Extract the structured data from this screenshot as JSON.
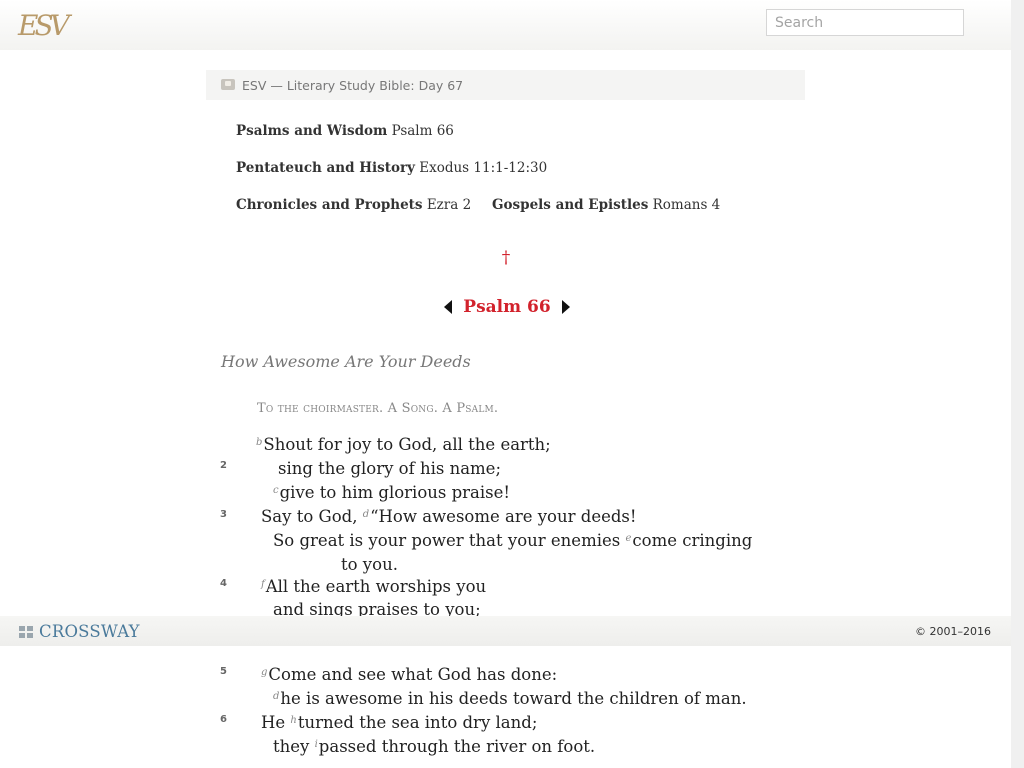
{
  "header": {
    "logo_text": "ESV",
    "search_placeholder": "Search"
  },
  "plan": {
    "title": "ESV — Literary Study Bible: Day 67",
    "readings": [
      {
        "category": "Psalms and Wisdom",
        "ref": "Psalm 66"
      },
      {
        "category": "Pentateuch and History",
        "ref": "Exodus 11:1-12:30"
      },
      {
        "category": "Chronicles and Prophets",
        "ref": "Ezra 2"
      },
      {
        "category": "Gospels and Epistles",
        "ref": "Romans 4"
      }
    ],
    "cross_glyph": "†"
  },
  "chapter": {
    "title": "Psalm 66",
    "section_heading": "How Awesome Are Your Deeds",
    "superscription": "To the choirmaster. A Song. A Psalm.",
    "verse_numbers": [
      "2",
      "3",
      "4",
      "5",
      "6"
    ],
    "lines": [
      {
        "fn": "b",
        "text": "Shout for joy to God, all the earth;"
      },
      {
        "fn": "",
        "text": "sing the glory of his name;"
      },
      {
        "fn": "c",
        "text": "give to him glorious praise!"
      },
      {
        "pre": "Say to God, ",
        "fn": "d",
        "text": "“How awesome are your deeds!"
      },
      {
        "pre": "So great is your power that your enemies ",
        "fn": "e",
        "text": "come cringing"
      },
      {
        "fn": "",
        "text": "to you."
      },
      {
        "fn": "f",
        "text": "All the earth worships you"
      },
      {
        "fn": "",
        "text": "and sings praises to you;"
      },
      {
        "fn": "g",
        "text": "Come and see what God has done:"
      },
      {
        "fn": "d",
        "text": "he is awesome in his deeds toward the children of man."
      },
      {
        "pre": "He ",
        "fn": "h",
        "text": "turned the sea into dry land;"
      },
      {
        "pre": "they ",
        "fn": "i",
        "text": "passed through the river on foot."
      }
    ]
  },
  "footer": {
    "brand": "CROSSWAY",
    "copyright": "© 2001–2016"
  }
}
